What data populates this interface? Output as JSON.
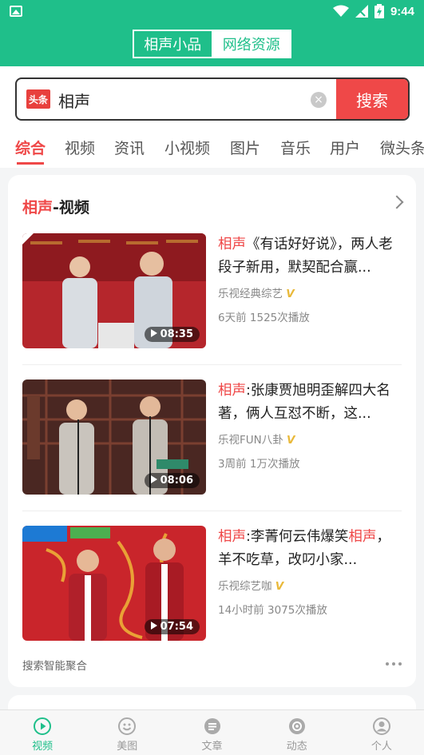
{
  "status": {
    "time": "9:44"
  },
  "header": {
    "tab_active": "相声小品",
    "tab_other": "网络资源"
  },
  "search": {
    "logo": "头条",
    "query": "相声",
    "button": "搜索"
  },
  "tabs": [
    "综合",
    "视频",
    "资讯",
    "小视频",
    "图片",
    "音乐",
    "用户",
    "微头条"
  ],
  "card": {
    "title_hl": "相声",
    "title_rest": "-视频",
    "items": [
      {
        "title_hl": "相声",
        "title_rest": "《有话好好说》，两人老段子新用，默契配合赢...",
        "source": "乐视经典综艺",
        "time": "6天前",
        "plays": "1525次播放",
        "duration": "08:35"
      },
      {
        "title_hl": "相声",
        "title_rest": ":张康贾旭明歪解四大名著，俩人互怼不断，这...",
        "source": "乐视FUN八卦",
        "time": "3周前",
        "plays": "1万次播放",
        "duration": "08:06"
      },
      {
        "title_hl": "相声",
        "title_mid": ":李菁何云伟爆笑",
        "title_hl2": "相声",
        "title_rest": "，羊不吃草，改叼小家...",
        "source": "乐视综艺咖",
        "time": "14小时前",
        "plays": "3075次播放",
        "duration": "07:54"
      }
    ],
    "footer": "搜索智能聚合"
  },
  "bottom_nav": [
    {
      "label": "视频",
      "icon": "play-circle-icon",
      "active": true
    },
    {
      "label": "美图",
      "icon": "smile-icon",
      "active": false
    },
    {
      "label": "文章",
      "icon": "article-icon",
      "active": false
    },
    {
      "label": "动态",
      "icon": "gear-icon",
      "active": false
    },
    {
      "label": "个人",
      "icon": "person-icon",
      "active": false
    }
  ],
  "colors": {
    "brand": "#1fbf8a",
    "accent": "#ef4848"
  }
}
